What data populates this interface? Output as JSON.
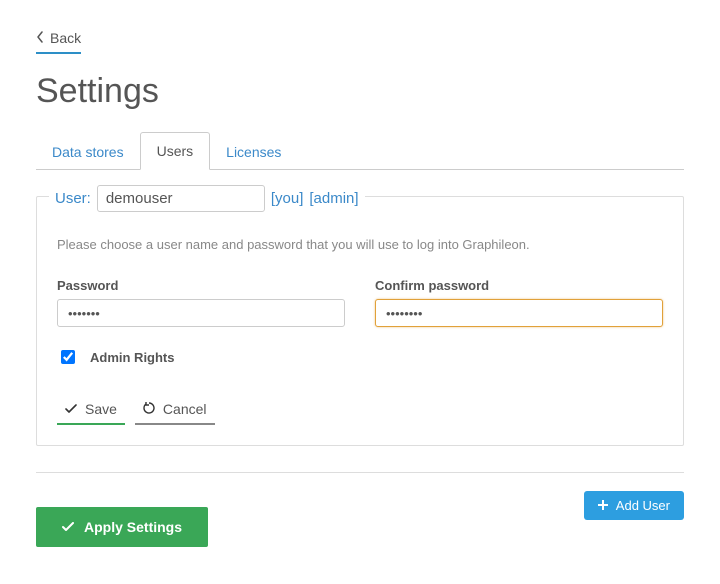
{
  "back": {
    "label": "Back"
  },
  "page_title": "Settings",
  "tabs": [
    {
      "label": "Data stores",
      "active": false
    },
    {
      "label": "Users",
      "active": true
    },
    {
      "label": "Licenses",
      "active": false
    }
  ],
  "user_panel": {
    "legend_label": "User:",
    "username_value": "demouser",
    "tag_you": "[you]",
    "tag_admin": "[admin]",
    "help_text": "Please choose a user name and password that you will use to log into Graphileon.",
    "password_label": "Password",
    "password_value": "•••••••",
    "confirm_label": "Confirm password",
    "confirm_value": "••••••••",
    "admin_rights_label": "Admin Rights",
    "admin_rights_checked": true,
    "save_label": "Save",
    "cancel_label": "Cancel"
  },
  "footer": {
    "add_user_label": "Add User",
    "apply_label": "Apply Settings"
  }
}
